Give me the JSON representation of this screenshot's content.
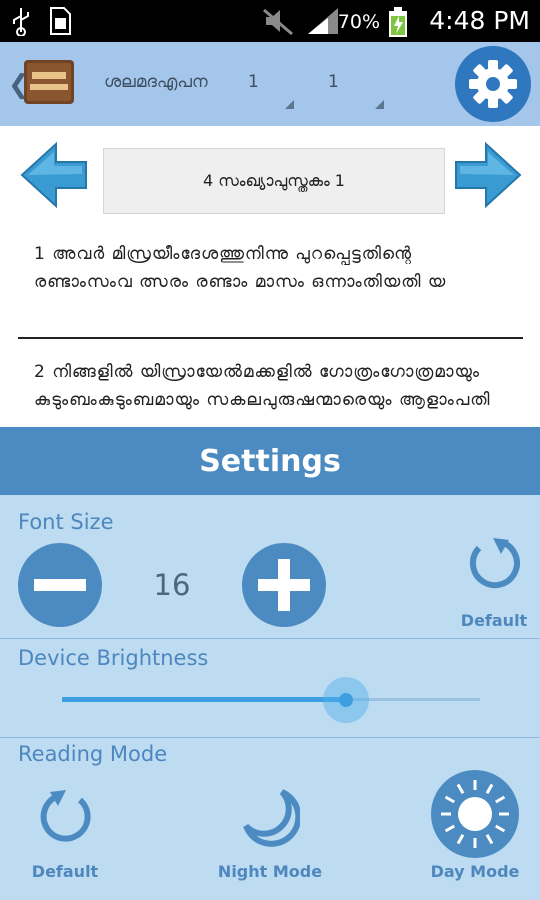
{
  "status_bar": {
    "battery_percent": "70%",
    "time": "4:48 PM",
    "icons": [
      "usb-icon",
      "sim-icon",
      "mute-icon",
      "signal-icon",
      "battery-charging-icon"
    ]
  },
  "action_bar": {
    "back_glyph": "❮",
    "book_selector": "ശലമദഎപന",
    "chapter_selector": "1",
    "verse_selector": "1"
  },
  "reader": {
    "chapter_title": "4 സംഖ്യാപുസ്തകം 1",
    "verses": [
      {
        "text": "1 അവർ മിസ്രയീംദേശത്തുനിന്നു പുറപ്പെട്ടതിന്റെ രണ്ടാംസംവ ത്സരം രണ്ടാം മാസം ഒന്നാംതിയതി യ"
      },
      {
        "text": "2 നിങ്ങളിൽ യിസ്രായേൽമക്കളിൽ ഗോത്രംഗോത്രമായും കുടുംബംകുടുംബമായും സകലപുരുഷന്മാരെയും ആളാംപതി"
      }
    ]
  },
  "settings": {
    "title": "Settings",
    "font_size": {
      "label": "Font Size",
      "value": "16",
      "default_label": "Default"
    },
    "brightness": {
      "label": "Device Brightness",
      "level_fraction": 0.68
    },
    "reading_mode": {
      "label": "Reading Mode",
      "options": [
        {
          "label": "Default",
          "icon": "refresh-icon",
          "selected": false
        },
        {
          "label": "Night Mode",
          "icon": "moon-icon",
          "selected": false
        },
        {
          "label": "Day Mode",
          "icon": "sun-icon",
          "selected": true
        }
      ]
    }
  },
  "colors": {
    "action_bar": "#a3c6ea",
    "panel_bg": "#bddbf1",
    "accent": "#4b8bc2",
    "label_blue": "#4d87be"
  }
}
